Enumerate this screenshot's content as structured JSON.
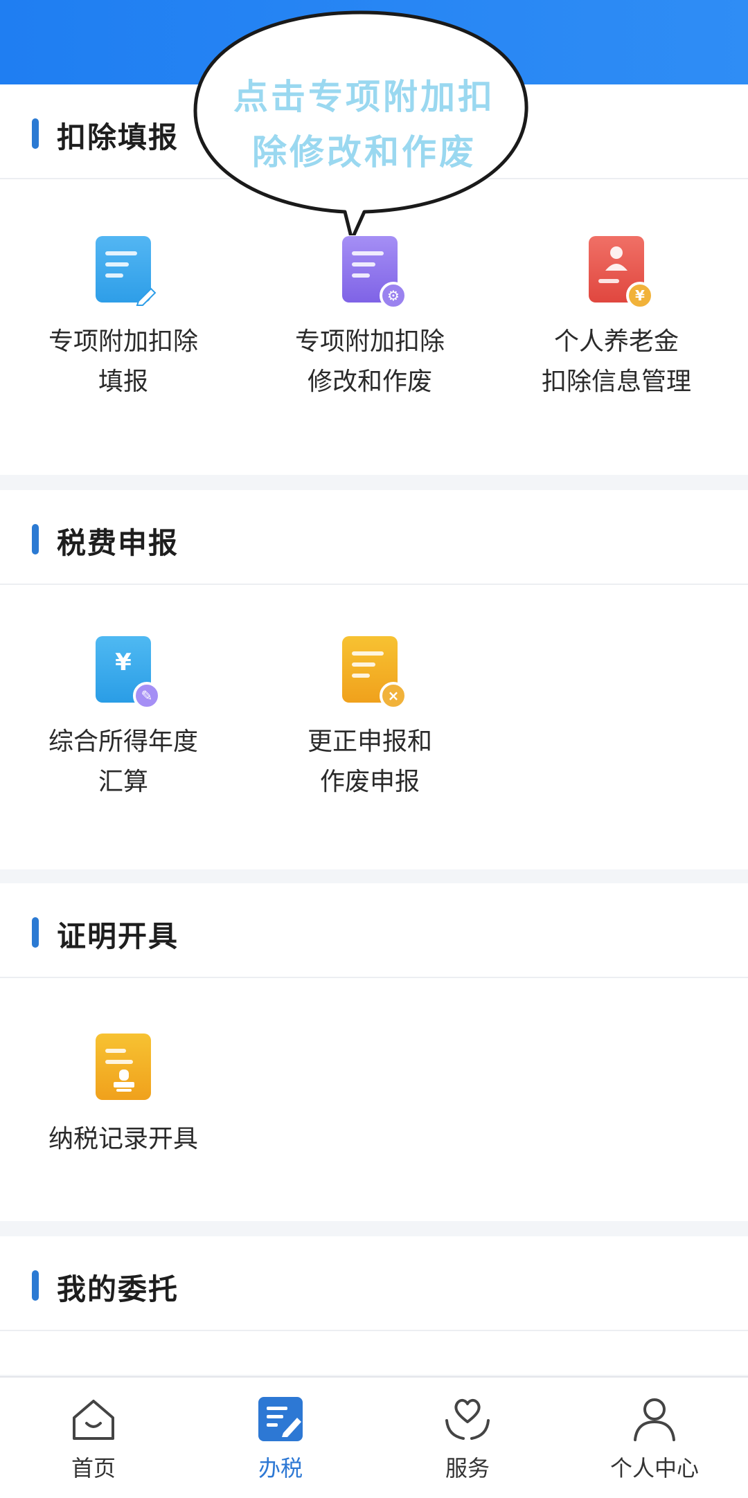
{
  "sections": [
    {
      "title": "扣除填报",
      "items": [
        {
          "label": "专项附加扣除\n填报",
          "icon": "edit-document-icon"
        },
        {
          "label": "专项附加扣除\n修改和作废",
          "icon": "settings-document-icon"
        },
        {
          "label": "个人养老金\n扣除信息管理",
          "icon": "pension-card-icon"
        }
      ]
    },
    {
      "title": "税费申报",
      "items": [
        {
          "label": "综合所得年度\n汇算",
          "icon": "yuan-document-icon"
        },
        {
          "label": "更正申报和\n作废申报",
          "icon": "cancel-document-icon"
        }
      ]
    },
    {
      "title": "证明开具",
      "items": [
        {
          "label": "纳税记录开具",
          "icon": "stamp-document-icon"
        }
      ]
    },
    {
      "title": "我的委托",
      "items": []
    }
  ],
  "bubble": {
    "line1": "点击专项附加扣",
    "line2": "除修改和作废"
  },
  "nav": {
    "items": [
      {
        "label": "首页",
        "icon": "home-icon"
      },
      {
        "label": "办税",
        "icon": "tax-document-icon"
      },
      {
        "label": "服务",
        "icon": "heart-hands-icon"
      },
      {
        "label": "个人中心",
        "icon": "user-icon"
      }
    ],
    "active": "办税"
  },
  "colors": {
    "banner": "#1f7ef2",
    "accent": "#2b7ad3",
    "bubble_text": "#9ad8f0"
  }
}
